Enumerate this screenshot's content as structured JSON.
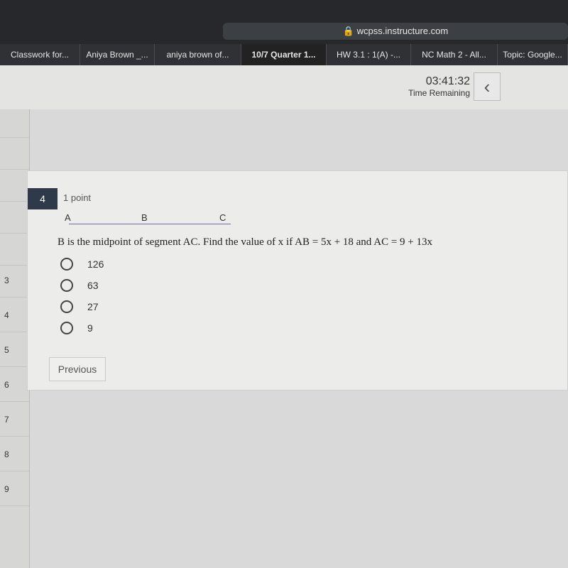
{
  "browser": {
    "url": "wcpss.instructure.com",
    "tabs": [
      "Classwork for...",
      "Aniya Brown _...",
      "aniya brown of...",
      "10/7 Quarter 1...",
      "HW 3.1 : 1(A) -...",
      "NC Math 2 - All...",
      "Topic: Google..."
    ],
    "active_tab": 3
  },
  "header": {
    "timer": "03:41:32",
    "timer_label": "Time Remaining",
    "back_icon": "chevron-left-icon"
  },
  "sidebar": {
    "items": [
      "",
      "",
      "",
      "",
      "",
      "3",
      "4",
      "5",
      "6",
      "7",
      "8",
      "9"
    ]
  },
  "question": {
    "number": "4",
    "points": "1 point",
    "points_a": "A",
    "points_b": "B",
    "points_c": "C",
    "text": "B is the midpoint of segment AC.  Find the value of x if AB = 5x + 18 and AC = 9 + 13x",
    "options": [
      "126",
      "63",
      "27",
      "9"
    ]
  },
  "nav": {
    "previous": "Previous"
  }
}
